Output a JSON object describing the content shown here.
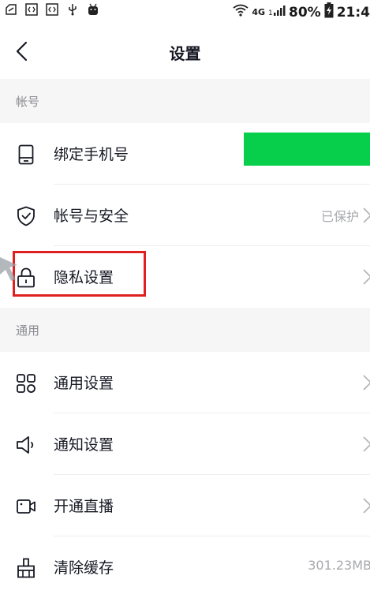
{
  "status_bar": {
    "network": "4G",
    "battery": "80%",
    "time": "21:4"
  },
  "nav": {
    "title": "设置"
  },
  "sections": [
    {
      "header": "帐号",
      "items": [
        {
          "label": "绑定手机号",
          "icon": "phone-icon",
          "value": ""
        },
        {
          "label": "帐号与安全",
          "icon": "shield-check-icon",
          "value": "已保护"
        },
        {
          "label": "隐私设置",
          "icon": "lock-icon",
          "value": ""
        }
      ]
    },
    {
      "header": "通用",
      "items": [
        {
          "label": "通用设置",
          "icon": "grid-icon",
          "value": ""
        },
        {
          "label": "通知设置",
          "icon": "speaker-icon",
          "value": ""
        },
        {
          "label": "开通直播",
          "icon": "video-camera-icon",
          "value": ""
        },
        {
          "label": "清除缓存",
          "icon": "broom-icon",
          "value": "301.23MB"
        }
      ]
    }
  ],
  "colors": {
    "highlight_box": "#e02020",
    "redaction_block": "#08cf4b",
    "section_background": "#f6f6f6"
  }
}
